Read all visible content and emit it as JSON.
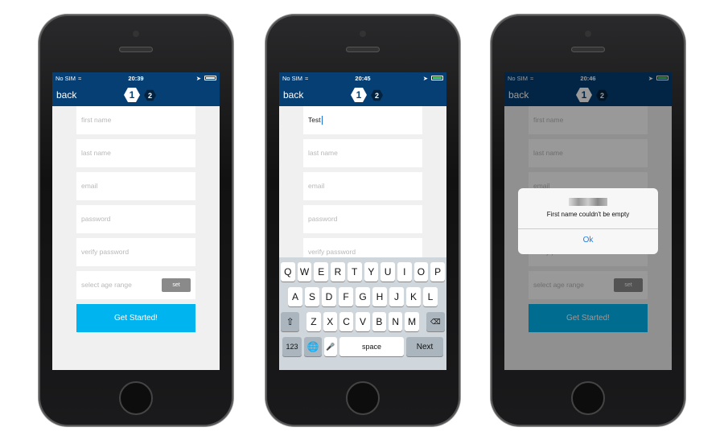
{
  "status": {
    "carrier": "No SIM"
  },
  "nav": {
    "back": "back",
    "step1": "1",
    "step2": "2"
  },
  "form": {
    "first_name": "first name",
    "last_name": "last name",
    "email": "email",
    "password": "password",
    "verify_password": "verify password",
    "age_range": "select age range",
    "set": "set",
    "submit": "Get Started!"
  },
  "screens": [
    {
      "time": "20:39",
      "battery_color": "#ffffff"
    },
    {
      "time": "20:45",
      "battery_color": "#4cd964",
      "first_name_value": "Test"
    },
    {
      "time": "20:46",
      "battery_color": "#4cd964"
    }
  ],
  "keyboard": {
    "rows": [
      [
        "Q",
        "W",
        "E",
        "R",
        "T",
        "Y",
        "U",
        "I",
        "O",
        "P"
      ],
      [
        "A",
        "S",
        "D",
        "F",
        "G",
        "H",
        "J",
        "K",
        "L"
      ],
      [
        "Z",
        "X",
        "C",
        "V",
        "B",
        "N",
        "M"
      ]
    ],
    "numbers": "123",
    "space": "space",
    "next": "Next"
  },
  "alert": {
    "message": "First name couldn't be empty",
    "ok": "Ok"
  },
  "colors": {
    "nav": "#063f73",
    "button": "#00b4f0"
  }
}
